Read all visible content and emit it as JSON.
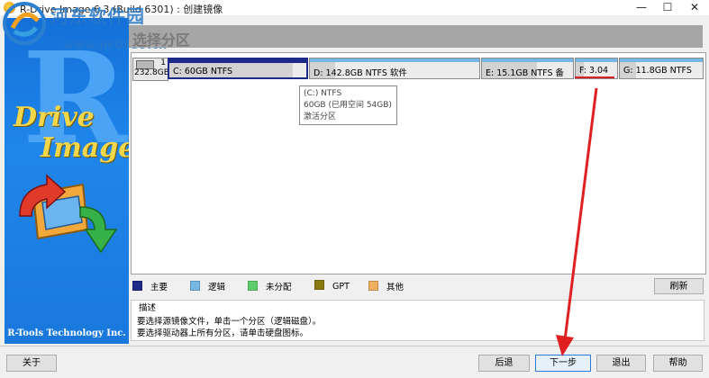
{
  "window": {
    "title": "R-Drive Image 6.3 (Build 6301) : 创建镜像",
    "minimize": "—",
    "maximize": "☐",
    "close": "✕"
  },
  "watermark": {
    "text": "河东软件园",
    "url": "www.pc0359.cn"
  },
  "brand": {
    "letter": "R",
    "word1": "Drive",
    "word2": "Image",
    "company": "R-Tools Technology Inc."
  },
  "header": {
    "title": "选择分区"
  },
  "disk": {
    "number": "1",
    "size": "232.8GB",
    "partitions": [
      {
        "label": "C:  60GB  NTFS",
        "type": "primary",
        "used": 0.9
      },
      {
        "label": "D:  142.8GB  NTFS  软件",
        "type": "logical",
        "used": 0.15
      },
      {
        "label": "E:  15.1GB  NTFS  备",
        "type": "logical",
        "used": 0.6
      },
      {
        "label": "F:  3.04",
        "type": "logical",
        "used": 0.2
      },
      {
        "label": "G:  11.8GB  NTFS",
        "type": "logical",
        "used": 0.2
      }
    ]
  },
  "tooltip": {
    "line1": "(C:) NTFS",
    "line2": "60GB (已用空间 54GB)",
    "line3": "激活分区"
  },
  "legend": [
    {
      "label": "主要",
      "color": "#1e2a88"
    },
    {
      "label": "逻辑",
      "color": "#77b7e6"
    },
    {
      "label": "未分配",
      "color": "#5fcd6c"
    },
    {
      "label": "GPT",
      "color": "#8a7a10"
    },
    {
      "label": "其他",
      "color": "#f0b060"
    }
  ],
  "refresh_label": "刷新",
  "description": {
    "title": "描述",
    "line1": "要选择源镜像文件，单击一个分区（逻辑磁盘）。",
    "line2": "要选择驱动器上所有分区，请单击硬盘图标。"
  },
  "buttons": {
    "about": "关于",
    "back": "后退",
    "next": "下一步",
    "exit": "退出",
    "help": "帮助"
  },
  "colors": {
    "accent_red": "#e02020",
    "brand_blue": "#1f86ea"
  }
}
